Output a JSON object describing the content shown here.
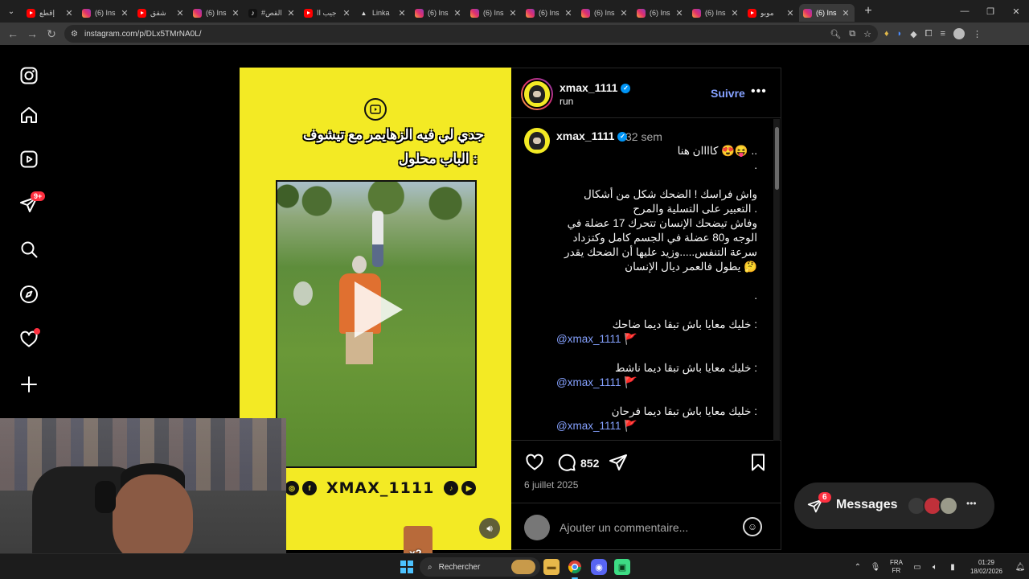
{
  "browser": {
    "tabs": [
      {
        "title": "إقطع",
        "favicon": "yt",
        "active": false
      },
      {
        "title": "(6) Ins",
        "favicon": "ig",
        "active": false
      },
      {
        "title": "شقق",
        "favicon": "yt",
        "active": false
      },
      {
        "title": "(6) Ins",
        "favicon": "ig",
        "active": false
      },
      {
        "title": "#القص",
        "favicon": "tt",
        "active": false
      },
      {
        "title": "جيب اا",
        "favicon": "yt",
        "active": false
      },
      {
        "title": "Linka",
        "favicon": "lk",
        "active": false
      },
      {
        "title": "(6) Ins",
        "favicon": "ig",
        "active": false
      },
      {
        "title": "(6) Ins",
        "favicon": "ig",
        "active": false
      },
      {
        "title": "(6) Ins",
        "favicon": "ig",
        "active": false
      },
      {
        "title": "(6) Ins",
        "favicon": "ig",
        "active": false
      },
      {
        "title": "(6) Ins",
        "favicon": "ig",
        "active": false
      },
      {
        "title": "(6) Ins",
        "favicon": "ig",
        "active": false
      },
      {
        "title": "موبو",
        "favicon": "yt",
        "active": false
      },
      {
        "title": "(6) Ins",
        "favicon": "ig",
        "active": true
      }
    ],
    "url": "instagram.com/p/DLx5TMrNA0L/"
  },
  "sidebar": {
    "notifications_badge": "9+"
  },
  "post": {
    "media": {
      "caption_line1": "جدي لي فيه الزهايمر مع تيشوف",
      "caption_line2": ": الباب محلول",
      "brand_name": "XMAX_1111"
    },
    "author": {
      "username": "xmax_1111",
      "subtitle": "run",
      "follow_label": "Suivre"
    },
    "caption": {
      "username": "xmax_1111",
      "time": "32 sem",
      "lines": [
        {
          "text": ".. 😝😍 كاااان هنا",
          "dir": "rtl"
        },
        {
          "text": ".",
          "dir": "rtl"
        },
        {
          "text": "",
          "dir": "rtl"
        },
        {
          "text": "واش فراسك ! الضحك شكل من  أشكال",
          "dir": "rtl"
        },
        {
          "text": ". التعبير على التسلية والمرح",
          "dir": "rtl"
        },
        {
          "text": "وفاش  تيضحك الإنسان تتحرك 17 عضلة في",
          "dir": "rtl"
        },
        {
          "text": "الوجه و80 عضلة في الجسم كامل وكتزداد",
          "dir": "rtl"
        },
        {
          "text": "سرعة التنفس.....وزيد عليها أن الضحك يقدر",
          "dir": "rtl"
        },
        {
          "text": "🤔 يطول فالعمر ديال الإنسان",
          "dir": "rtl"
        },
        {
          "text": "",
          "dir": "rtl"
        },
        {
          "text": ".",
          "dir": "rtl"
        },
        {
          "text": "",
          "dir": "rtl"
        },
        {
          "text": ": خليك معايا باش تبقا  ديما ضاحك",
          "dir": "rtl"
        },
        {
          "text": "@xmax_1111 🚩",
          "dir": "ltr",
          "mention": true
        },
        {
          "text": "",
          "dir": "rtl"
        },
        {
          "text": ": خليك معايا باش تبقا  ديما ناشط",
          "dir": "rtl"
        },
        {
          "text": "@xmax_1111 🚩",
          "dir": "ltr",
          "mention": true
        },
        {
          "text": "",
          "dir": "rtl"
        },
        {
          "text": ": خليك معايا باش تبقا  ديما فرحان",
          "dir": "rtl"
        },
        {
          "text": "@xmax_1111 🚩",
          "dir": "ltr",
          "mention": true
        }
      ]
    },
    "actions": {
      "comments_count": "852",
      "date": "6 juillet 2025"
    },
    "comment_placeholder": "Ajouter un commentaire..."
  },
  "messages": {
    "label": "Messages",
    "badge": "6"
  },
  "overlay": {
    "sticker_text": "x2"
  },
  "taskbar": {
    "search_placeholder": "Rechercher",
    "lang_top": "FRA",
    "lang_bottom": "FR",
    "time": "01:29",
    "date": "18/02/2026"
  },
  "colors": {
    "media_bg": "#f3ea24",
    "link": "#85a1ff",
    "badge": "#ff3040",
    "verified": "#0095f6"
  }
}
